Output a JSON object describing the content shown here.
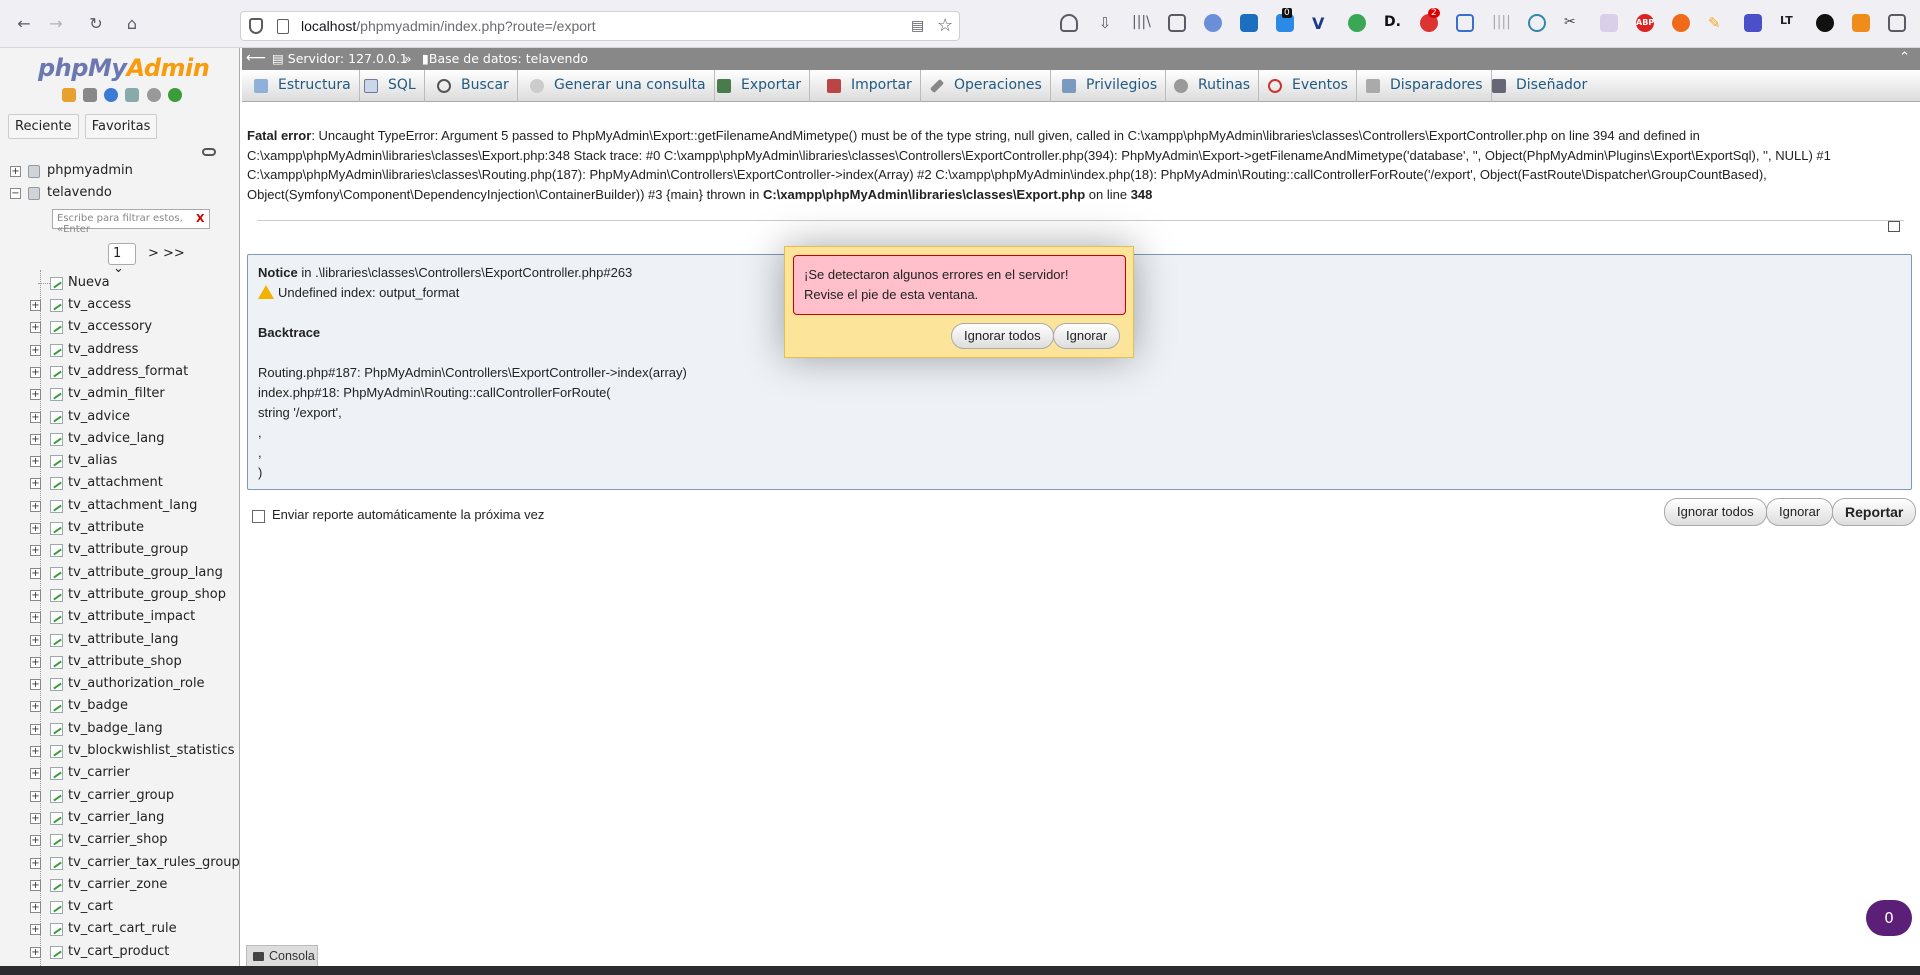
{
  "browser": {
    "url_host": "localhost",
    "url_path": "/phpmyadmin/index.php?route=/export",
    "ext_badge_1": "0",
    "ext_badge_2": "2",
    "ext_abp": "ABP",
    "ext_lt": "LT"
  },
  "sidebar": {
    "logo_php": "php",
    "logo_my": "My",
    "logo_admin": "Admin",
    "recent_label": "Reciente",
    "favorites_label": "Favoritas",
    "databases": [
      "phpmyadmin",
      "telavendo"
    ],
    "filter_placeholder": "Escribe para filtrar estos, «Enter",
    "filter_clear": "X",
    "page_select": "1",
    "page_next": "> >>",
    "new_label": "Nueva",
    "tables": [
      "tv_access",
      "tv_accessory",
      "tv_address",
      "tv_address_format",
      "tv_admin_filter",
      "tv_advice",
      "tv_advice_lang",
      "tv_alias",
      "tv_attachment",
      "tv_attachment_lang",
      "tv_attribute",
      "tv_attribute_group",
      "tv_attribute_group_lang",
      "tv_attribute_group_shop",
      "tv_attribute_impact",
      "tv_attribute_lang",
      "tv_attribute_shop",
      "tv_authorization_role",
      "tv_badge",
      "tv_badge_lang",
      "tv_blockwishlist_statistics",
      "tv_carrier",
      "tv_carrier_group",
      "tv_carrier_lang",
      "tv_carrier_shop",
      "tv_carrier_tax_rules_group_sh",
      "tv_carrier_zone",
      "tv_cart",
      "tv_cart_cart_rule",
      "tv_cart_product"
    ]
  },
  "breadcrumb": {
    "server": "Servidor: 127.0.0.1",
    "separator": "»",
    "database": "Base de datos: telavendo"
  },
  "menu_tabs": [
    "Estructura",
    "SQL",
    "Buscar",
    "Generar una consulta",
    "Exportar",
    "Importar",
    "Operaciones",
    "Privilegios",
    "Rutinas",
    "Eventos",
    "Disparadores",
    "Diseñador"
  ],
  "error": {
    "fatal_label": "Fatal error",
    "fatal_text": ": Uncaught TypeError: Argument 5 passed to PhpMyAdmin\\Export::getFilenameAndMimetype() must be of the type string, null given, called in C:\\xampp\\phpMyAdmin\\libraries\\classes\\Controllers\\ExportController.php on line 394 and defined in C:\\xampp\\phpMyAdmin\\libraries\\classes\\Export.php:348 Stack trace: #0 C:\\xampp\\phpMyAdmin\\libraries\\classes\\Controllers\\ExportController.php(394): PhpMyAdmin\\Export->getFilenameAndMimetype('database', '', Object(PhpMyAdmin\\Plugins\\Export\\ExportSql), '', NULL) #1 C:\\xampp\\phpMyAdmin\\libraries\\classes\\Routing.php(187): PhpMyAdmin\\Controllers\\ExportController->index(Array) #2 C:\\xampp\\phpMyAdmin\\index.php(18): PhpMyAdmin\\Routing::callControllerForRoute('/export', Object(FastRoute\\Dispatcher\\GroupCountBased), Object(Symfony\\Component\\DependencyInjection\\ContainerBuilder)) #3 {main} thrown in ",
    "fatal_file": "C:\\xampp\\phpMyAdmin\\libraries\\classes\\Export.php",
    "fatal_online": " on line ",
    "fatal_line": "348"
  },
  "notice": {
    "label": "Notice",
    "location": " in .\\libraries\\classes\\Controllers\\ExportController.php#263",
    "message": "Undefined index: output_format",
    "backtrace_title": "Backtrace",
    "trace_lines": [
      "Routing.php#187: PhpMyAdmin\\Controllers\\ExportController->index(array)",
      "index.php#18: PhpMyAdmin\\Routing::callControllerForRoute(",
      "string '/export',",
      ",",
      ",",
      ")"
    ]
  },
  "report": {
    "checkbox_label": "Enviar reporte automáticamente la próxima vez",
    "ignore_all": "Ignorar todos",
    "ignore": "Ignorar",
    "report": "Reportar"
  },
  "modal": {
    "line1": "¡Se detectaron algunos errores en el servidor!",
    "line2": "Revise el pie de esta ventana.",
    "ignore_all": "Ignorar todos",
    "ignore": "Ignorar"
  },
  "console_label": "Consola",
  "notification_count": "0"
}
